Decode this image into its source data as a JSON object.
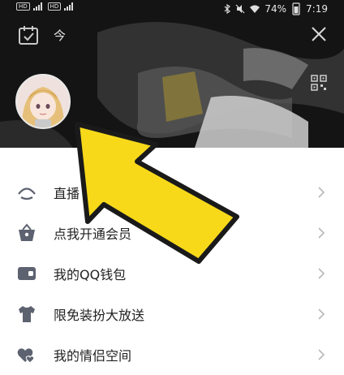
{
  "status_bar": {
    "left_badges": [
      "HD",
      "HD"
    ],
    "battery": "74%",
    "time": "7:19"
  },
  "header": {
    "title": "今",
    "icons": [
      "calendar-check-icon",
      "close-icon",
      "qr-code-icon"
    ]
  },
  "menu": {
    "items": [
      {
        "label": "直播",
        "icon": "live-icon"
      },
      {
        "label": "点我开通会员",
        "icon": "vip-basket-icon"
      },
      {
        "label": "我的QQ钱包",
        "icon": "wallet-icon"
      },
      {
        "label": "限免装扮大放送",
        "icon": "shirt-icon"
      },
      {
        "label": "我的情侣空间",
        "icon": "hearts-icon"
      }
    ]
  },
  "colors": {
    "arrow_fill": "#f7d91a",
    "arrow_stroke": "#1a1a1a",
    "icon_gray": "#5d6270",
    "chevron": "#b8b8b8"
  }
}
